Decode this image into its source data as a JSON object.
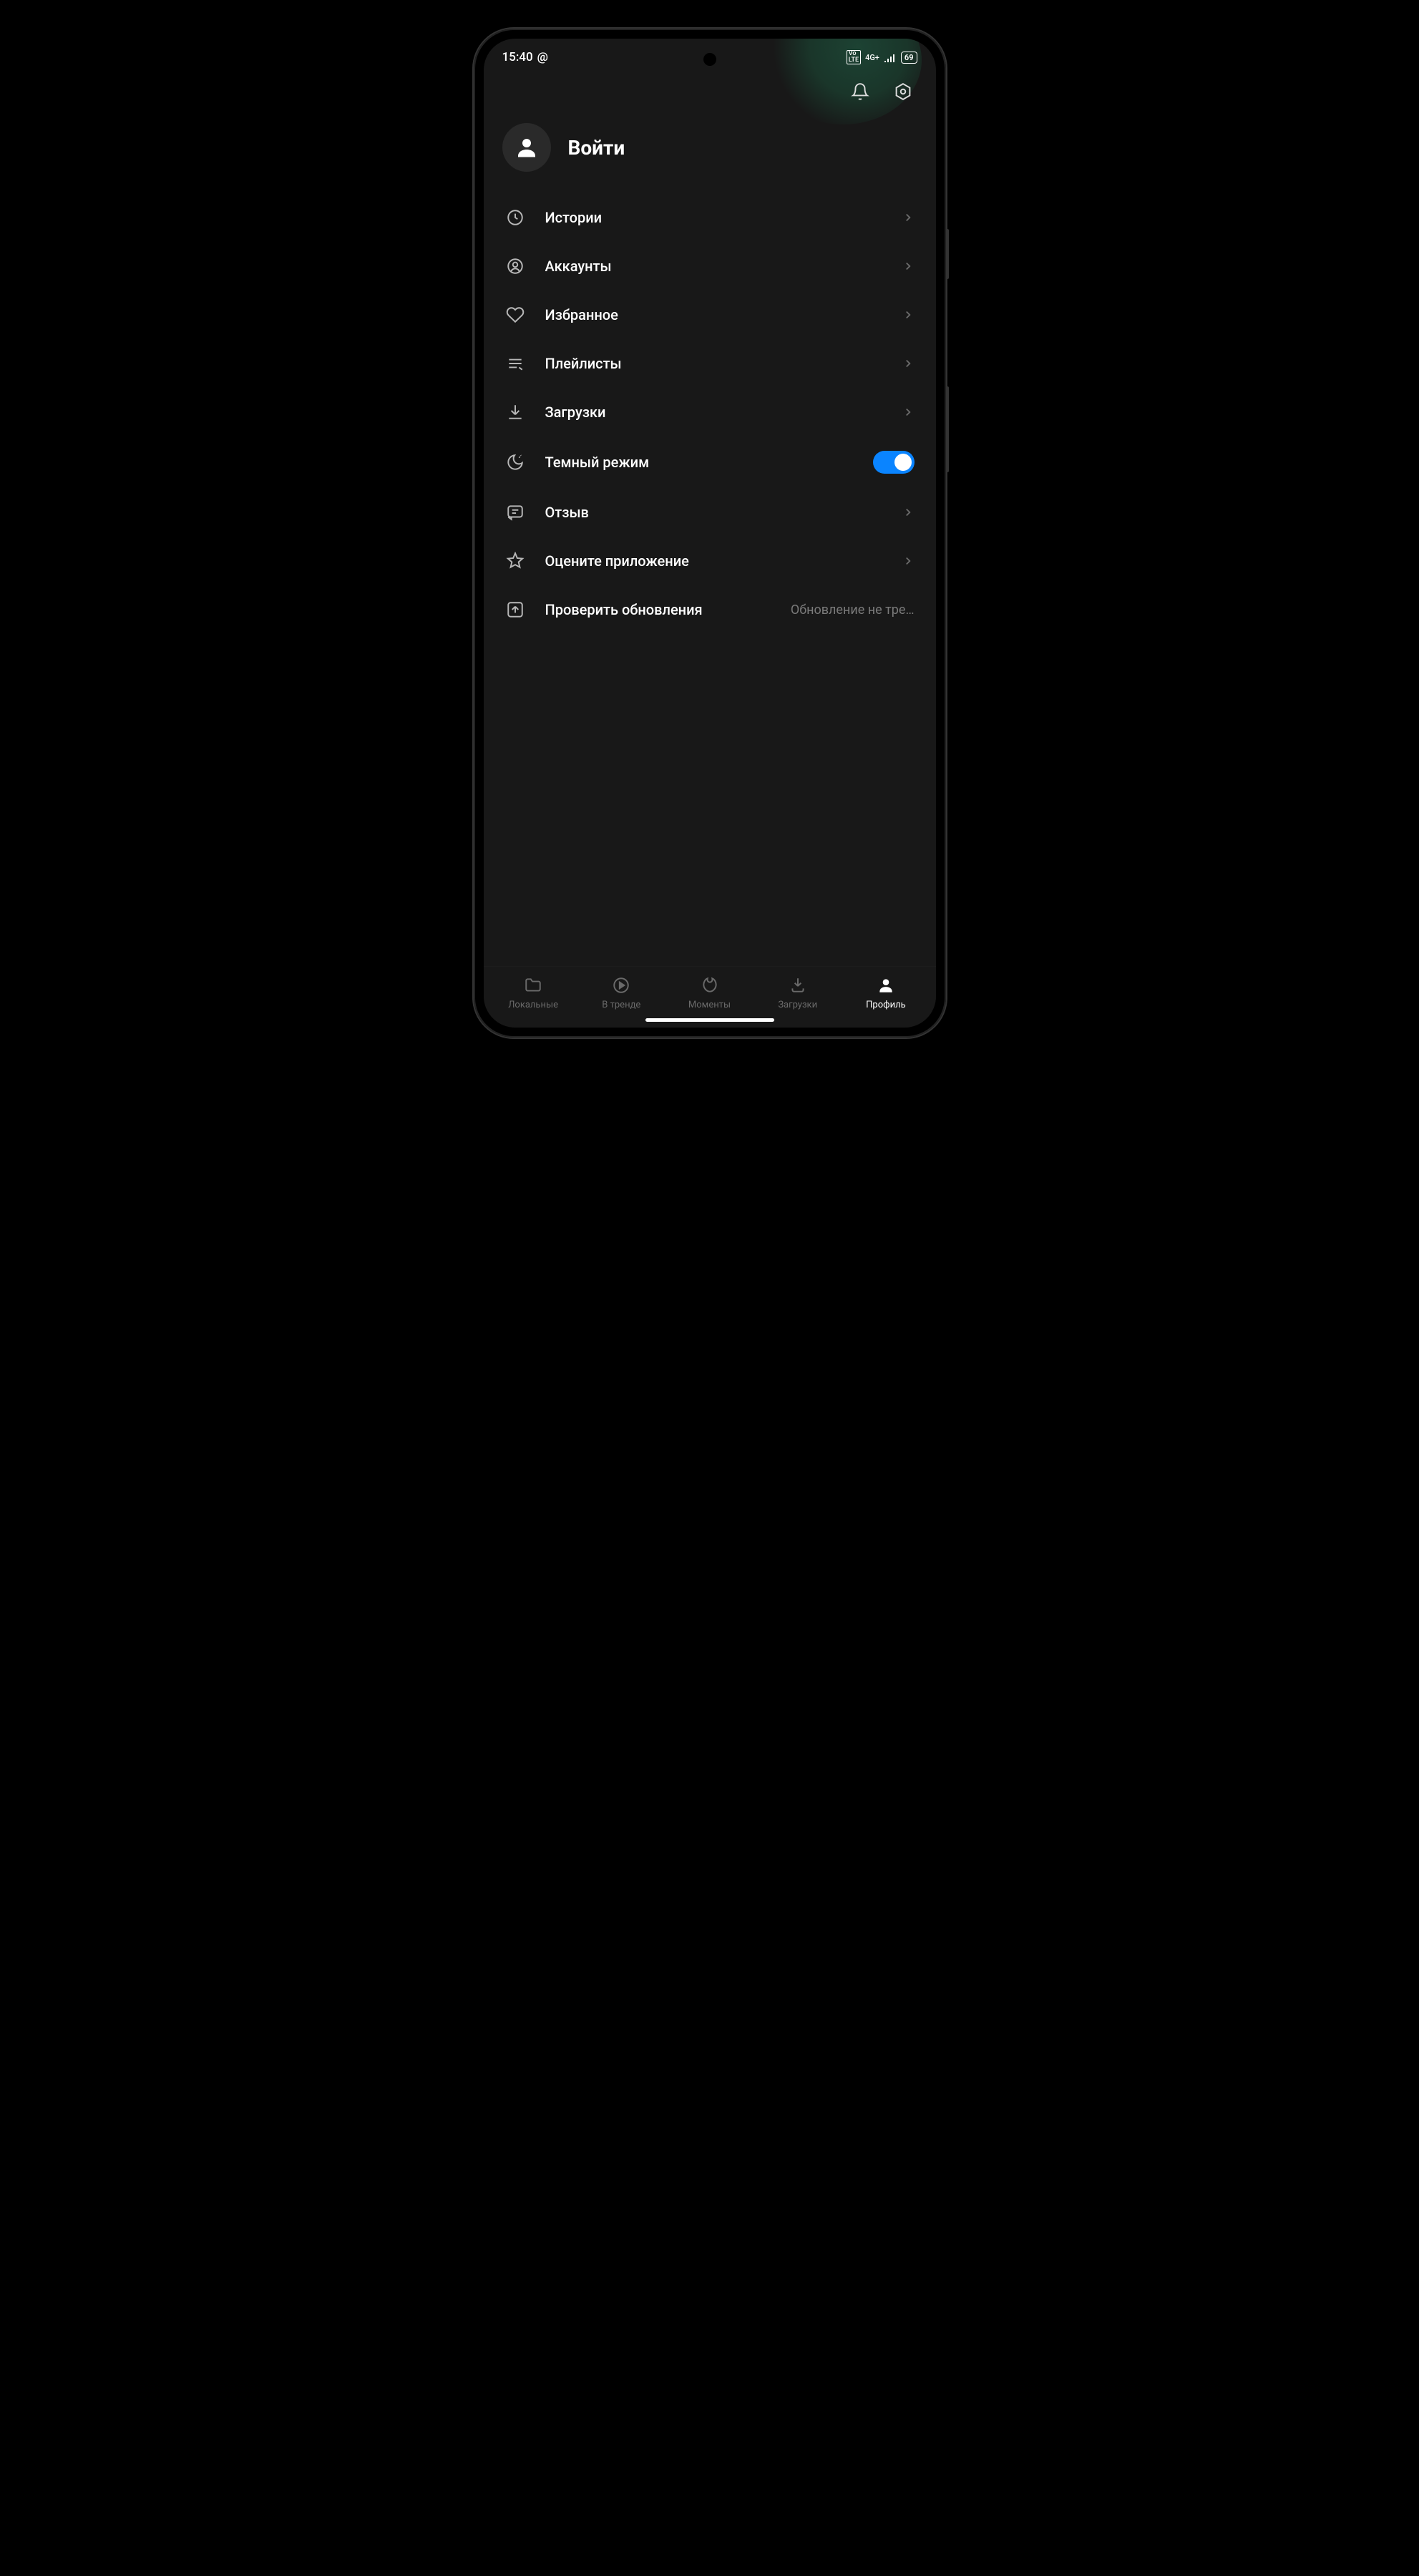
{
  "status": {
    "time": "15:40",
    "at_symbol": "@",
    "volte": "Vo LTE",
    "net": "4G+",
    "battery": "69"
  },
  "login": {
    "label": "Войти"
  },
  "menu": [
    {
      "icon": "clock",
      "label": "Истории",
      "action": "chevron"
    },
    {
      "icon": "account",
      "label": "Аккаунты",
      "action": "chevron"
    },
    {
      "icon": "heart",
      "label": "Избранное",
      "action": "chevron"
    },
    {
      "icon": "playlist",
      "label": "Плейлисты",
      "action": "chevron"
    },
    {
      "icon": "download",
      "label": "Загрузки",
      "action": "chevron"
    },
    {
      "icon": "moon",
      "label": "Темный режим",
      "action": "toggle",
      "toggle_on": true
    },
    {
      "icon": "feedback",
      "label": "Отзыв",
      "action": "chevron"
    },
    {
      "icon": "star",
      "label": "Оцените приложение",
      "action": "chevron"
    },
    {
      "icon": "update",
      "label": "Проверить обновления",
      "sublabel": "Обновление не тре…",
      "action": "none"
    }
  ],
  "nav": [
    {
      "icon": "folder",
      "label": "Локальные",
      "active": false
    },
    {
      "icon": "play",
      "label": "В тренде",
      "active": false
    },
    {
      "icon": "moments",
      "label": "Моменты",
      "active": false
    },
    {
      "icon": "dl",
      "label": "Загрузки",
      "active": false
    },
    {
      "icon": "profile",
      "label": "Профиль",
      "active": true
    }
  ]
}
